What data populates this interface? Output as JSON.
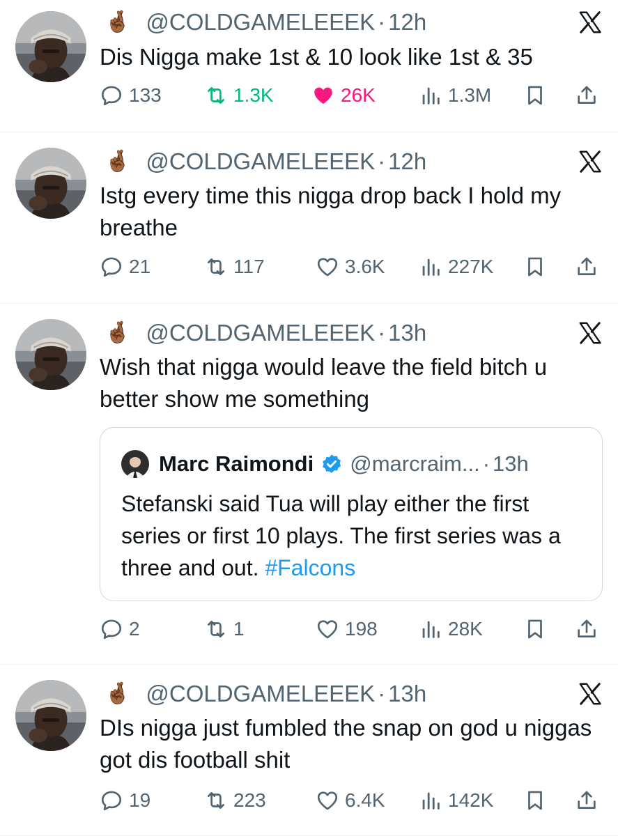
{
  "tweets": [
    {
      "emoji": "🤞🏾",
      "handle": "@COLDGAMELEEEK",
      "time": "12h",
      "text": "Dis Nigga make 1st & 10 look like 1st & 35",
      "replies": "133",
      "retweets": "1.3K",
      "likes": "26K",
      "views": "1.3M",
      "liked": true,
      "retweeted": true
    },
    {
      "emoji": "🤞🏾",
      "handle": "@COLDGAMELEEEK",
      "time": "12h",
      "text": "Istg every time this nigga drop back I hold my breathe",
      "replies": "21",
      "retweets": "117",
      "likes": "3.6K",
      "views": "227K",
      "liked": false,
      "retweeted": false
    },
    {
      "emoji": "🤞🏾",
      "handle": "@COLDGAMELEEEK",
      "time": "13h",
      "text": "Wish that nigga would leave the field bitch u better show me something",
      "replies": "2",
      "retweets": "1",
      "likes": "198",
      "views": "28K",
      "liked": false,
      "retweeted": false,
      "quote": {
        "name": "Marc Raimondi",
        "handle": "@marcraim...",
        "time": "13h",
        "text": "Stefanski said Tua will play either the first series or first 10 plays. The first series was a three and out.",
        "hashtag": "#Falcons"
      }
    },
    {
      "emoji": "🤞🏾",
      "handle": "@COLDGAMELEEEK",
      "time": "13h",
      "text": "DIs nigga just fumbled the snap on god u niggas got dis football shit",
      "replies": "19",
      "retweets": "223",
      "likes": "6.4K",
      "views": "142K",
      "liked": false,
      "retweeted": false
    }
  ],
  "separator": "·",
  "icons": {
    "reply": "reply-icon",
    "retweet": "retweet-icon",
    "like": "heart-icon",
    "views": "views-icon",
    "bookmark": "bookmark-icon",
    "share": "share-icon",
    "platform": "x-logo-icon",
    "verified": "verified-badge-icon"
  },
  "colors": {
    "text": "#0f1419",
    "muted": "#536471",
    "retweet_active": "#00ba7c",
    "like_active": "#f91880",
    "link": "#1d9bf0",
    "verified": "#1d9bf0"
  }
}
